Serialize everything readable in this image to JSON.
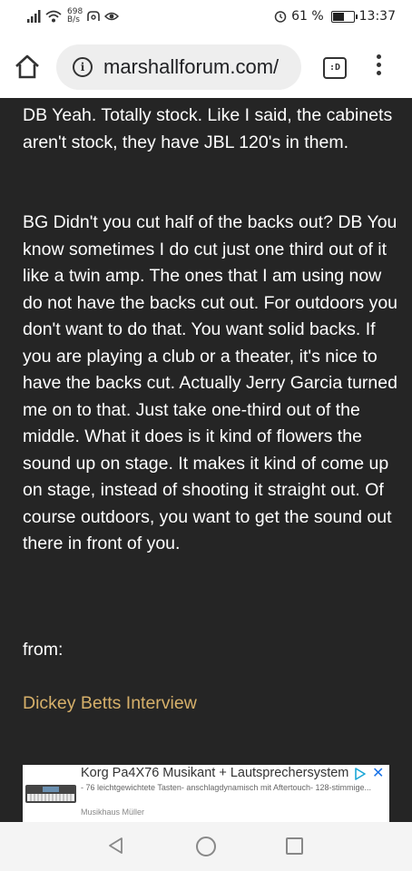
{
  "status_bar": {
    "net_speed_value": "698",
    "net_speed_unit": "B/s",
    "battery": "61 %",
    "battery_level": 0.61,
    "time": "13:37"
  },
  "browser": {
    "url": "marshallforum.com/",
    "tab_switcher_label": ":D"
  },
  "article": {
    "partial_top_line": "",
    "paragraph1": "DB Yeah. Totally stock. Like I said, the cabinets aren't stock, they have JBL 120's in them.",
    "paragraph2": "BG Didn't you cut half of the backs out? DB You know sometimes I do cut just one third out of it like a twin amp. The ones that I am using now do not have the backs cut out. For outdoors you don't want to do that. You want solid backs. If you are playing a club or a theater, it's nice to have the backs cut. Actually Jerry Garcia turned me on to that. Just take one-third out of the middle. What it does is it kind of flowers the sound up on stage. It makes it kind of come up on stage, instead of shooting it straight out. Of course outdoors, you want to get the sound out there in front of you.",
    "from_label": "from:",
    "link_text": "Dickey Betts Interview"
  },
  "ad": {
    "title": "Korg Pa4X76 Musikant + Lautsprechersystem",
    "description": "- 76 leichtgewichtete Tasten- anschlagdynamisch mit Aftertouch- 128-stimmige...",
    "source": "Musikhaus Müller",
    "close_symbol": "✕"
  },
  "colors": {
    "page_bg": "#252525",
    "text": "#ffffff",
    "link": "#d6b06a"
  }
}
